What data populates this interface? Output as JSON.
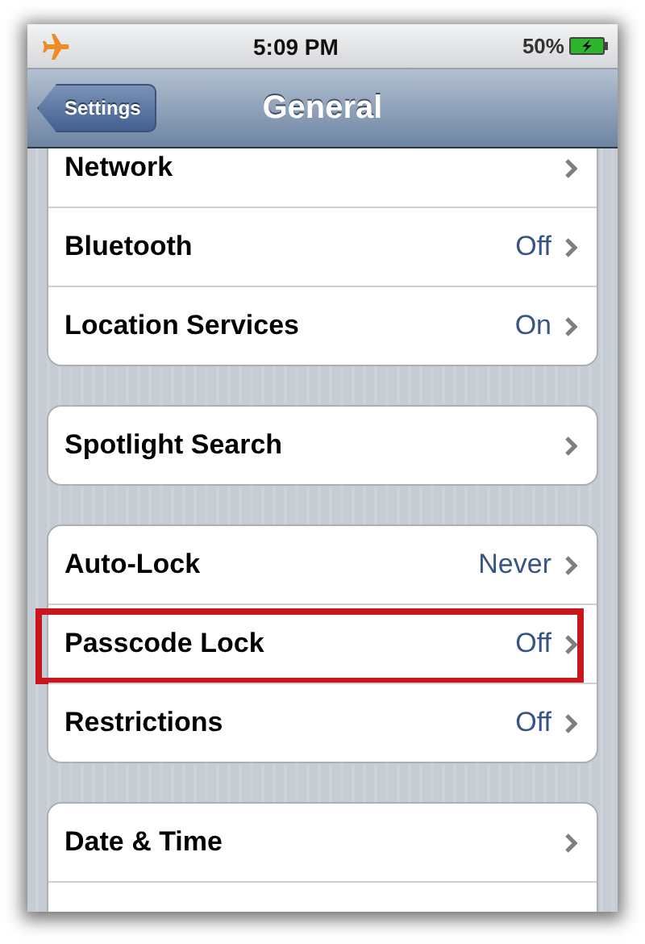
{
  "status_bar": {
    "airplane_mode": true,
    "time": "5:09 PM",
    "battery": "50%",
    "charging": true
  },
  "nav_bar": {
    "back": "Settings",
    "title": "General"
  },
  "groups": [
    {
      "rows": [
        {
          "label": "Network",
          "value": "",
          "highlighted": false
        },
        {
          "label": "Bluetooth",
          "value": "Off",
          "highlighted": false
        },
        {
          "label": "Location Services",
          "value": "On",
          "highlighted": false
        }
      ]
    },
    {
      "rows": [
        {
          "label": "Spotlight Search",
          "value": "",
          "highlighted": false
        }
      ]
    },
    {
      "rows": [
        {
          "label": "Auto-Lock",
          "value": "Never",
          "highlighted": false
        },
        {
          "label": "Passcode Lock",
          "value": "Off",
          "highlighted": true
        },
        {
          "label": "Restrictions",
          "value": "Off",
          "highlighted": false
        }
      ]
    },
    {
      "rows": [
        {
          "label": "Date & Time",
          "value": "",
          "highlighted": false
        },
        {
          "label": "",
          "value": "",
          "highlighted": false
        }
      ]
    }
  ]
}
